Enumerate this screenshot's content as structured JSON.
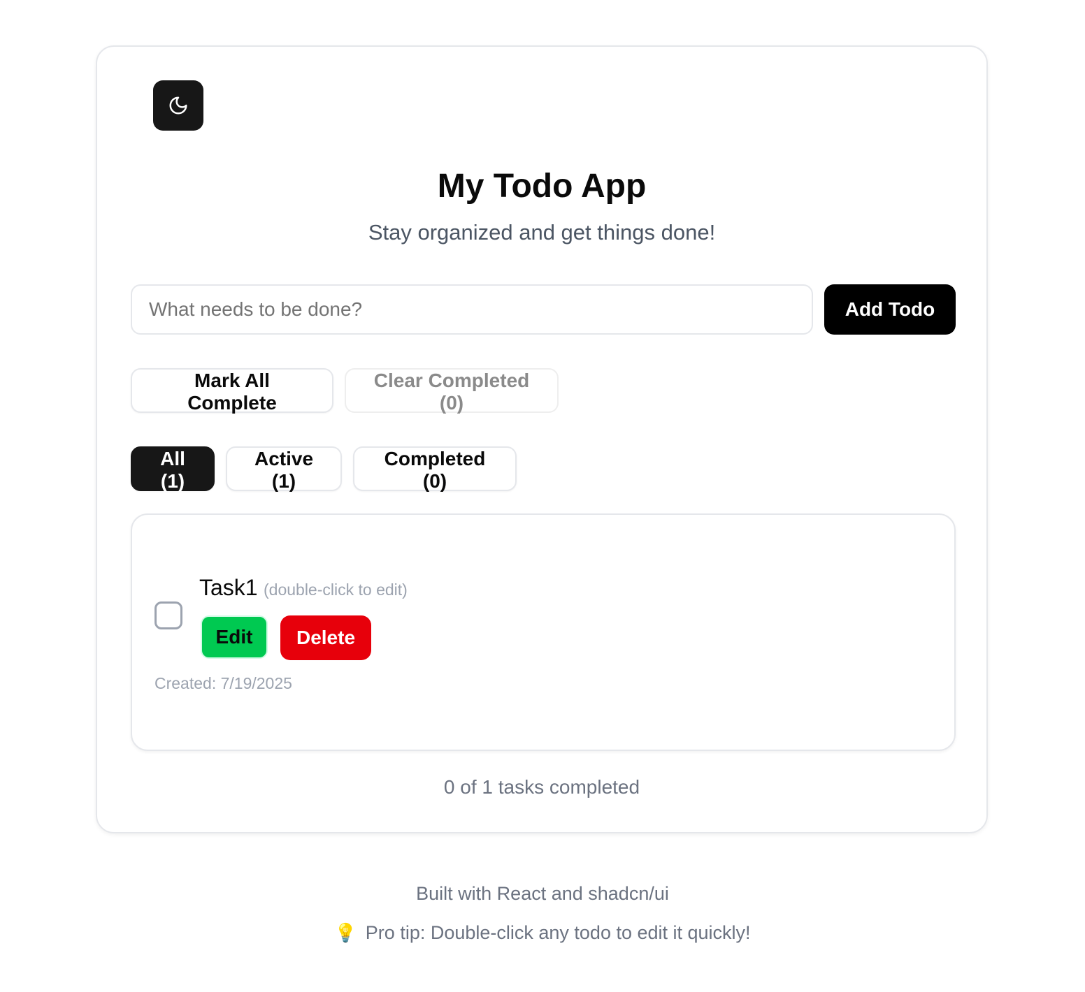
{
  "header": {
    "theme_toggle_icon": "moon-icon",
    "title": "My Todo App",
    "subtitle": "Stay organized and get things done!"
  },
  "input": {
    "placeholder": "What needs to be done?",
    "value": "",
    "add_label": "Add Todo"
  },
  "bulk_actions": {
    "mark_all_label": "Mark All Complete",
    "clear_completed_label": "Clear Completed (0)"
  },
  "filters": [
    {
      "label": "All (1)",
      "active": true
    },
    {
      "label": "Active (1)",
      "active": false
    },
    {
      "label": "Completed (0)",
      "active": false
    }
  ],
  "todos": [
    {
      "text": "Task1",
      "hint": "(double-click to edit)",
      "completed": false,
      "edit_label": "Edit",
      "delete_label": "Delete",
      "created": "Created: 7/19/2025"
    }
  ],
  "summary": "0 of 1 tasks completed",
  "footer": {
    "built_with": "Built with React and shadcn/ui",
    "tip_icon": "lightbulb-icon",
    "tip": "Pro tip: Double-click any todo to edit it quickly!"
  },
  "colors": {
    "primary": "#171717",
    "add_button": "#000000",
    "edit_button": "#00c951",
    "delete_button": "#e7000b",
    "muted_text": "#6b7280"
  }
}
